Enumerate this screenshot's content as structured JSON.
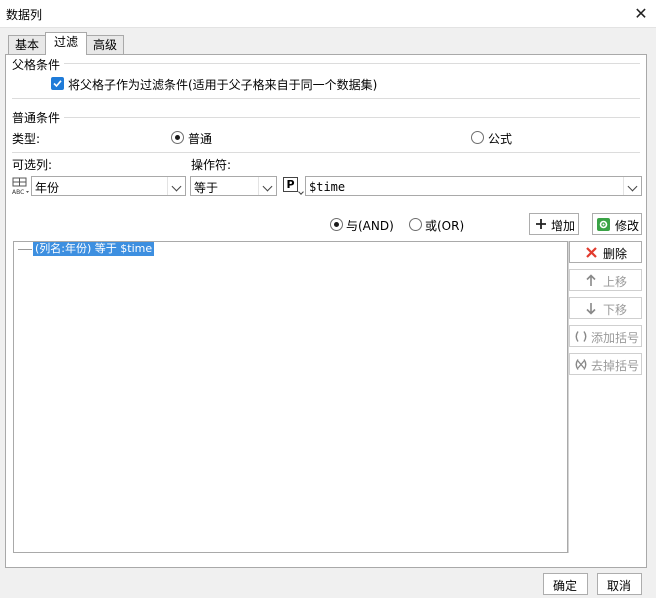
{
  "window": {
    "title": "数据列",
    "close_glyph": "✕"
  },
  "tabs": [
    {
      "label": "基本",
      "active": false
    },
    {
      "label": "过滤",
      "active": true
    },
    {
      "label": "高级",
      "active": false
    }
  ],
  "parent_section": {
    "title": "父格条件",
    "checkbox_label": "将父格子作为过滤条件(适用于父子格来自于同一个数据集)",
    "checked": true
  },
  "common_section": {
    "title": "普通条件",
    "type_label": "类型:",
    "type_options": [
      "普通",
      "公式"
    ],
    "type_selected": "普通",
    "column_label": "可选列:",
    "operator_label": "操作符:",
    "column_value": "年份",
    "operator_value": "等于",
    "param_icon_letter": "P",
    "param_value": "$time",
    "logic_options": [
      "与(AND)",
      "或(OR)"
    ],
    "logic_selected": "与(AND)",
    "add_button": "增加",
    "modify_button": "修改"
  },
  "condition_list": {
    "items": [
      "(列名:年份) 等于 $time"
    ]
  },
  "side_buttons": {
    "delete": "删除",
    "move_up": "上移",
    "move_down": "下移",
    "add_bracket": "添加括号",
    "remove_bracket": "去掉括号"
  },
  "footer": {
    "ok": "确定",
    "cancel": "取消"
  },
  "colors": {
    "accent": "#1f7bd8",
    "selection": "#3d8fe0",
    "delete_red": "#e23b2e",
    "modify_green": "#2e9b3a"
  }
}
